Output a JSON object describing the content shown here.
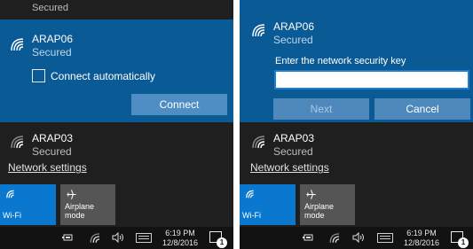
{
  "left_panel": {
    "top_cut_status": "Secured",
    "selected_network": {
      "name": "ARAP06",
      "status": "Secured"
    },
    "connect_automatically_label": "Connect automatically",
    "connect_automatically_checked": false,
    "connect_button": "Connect",
    "other_network": {
      "name": "ARAP03",
      "status": "Secured"
    },
    "network_settings": "Network settings",
    "tiles": {
      "wifi": "Wi-Fi",
      "airplane": "Airplane mode"
    },
    "taskbar": {
      "time": "6:19 PM",
      "date": "12/8/2016",
      "notification_count": "1"
    }
  },
  "right_panel": {
    "selected_network": {
      "name": "ARAP06",
      "status": "Secured"
    },
    "security_key_label": "Enter the network security key",
    "security_key_value": "",
    "next_button": "Next",
    "cancel_button": "Cancel",
    "other_network": {
      "name": "ARAP03",
      "status": "Secured"
    },
    "network_settings": "Network settings",
    "tiles": {
      "wifi": "Wi-Fi",
      "airplane": "Airplane mode"
    },
    "taskbar": {
      "time": "6:19 PM",
      "date": "12/8/2016",
      "notification_count": "1"
    }
  },
  "colors": {
    "selected_bg": "#0a5a96",
    "panel_bg": "#1f1f1f",
    "accent": "#0b78d0",
    "button": "#4f8ec3"
  },
  "icons": [
    "wifi-signal-icon",
    "airplane-icon",
    "battery-icon",
    "volume-icon",
    "keyboard-icon",
    "notification-icon"
  ]
}
